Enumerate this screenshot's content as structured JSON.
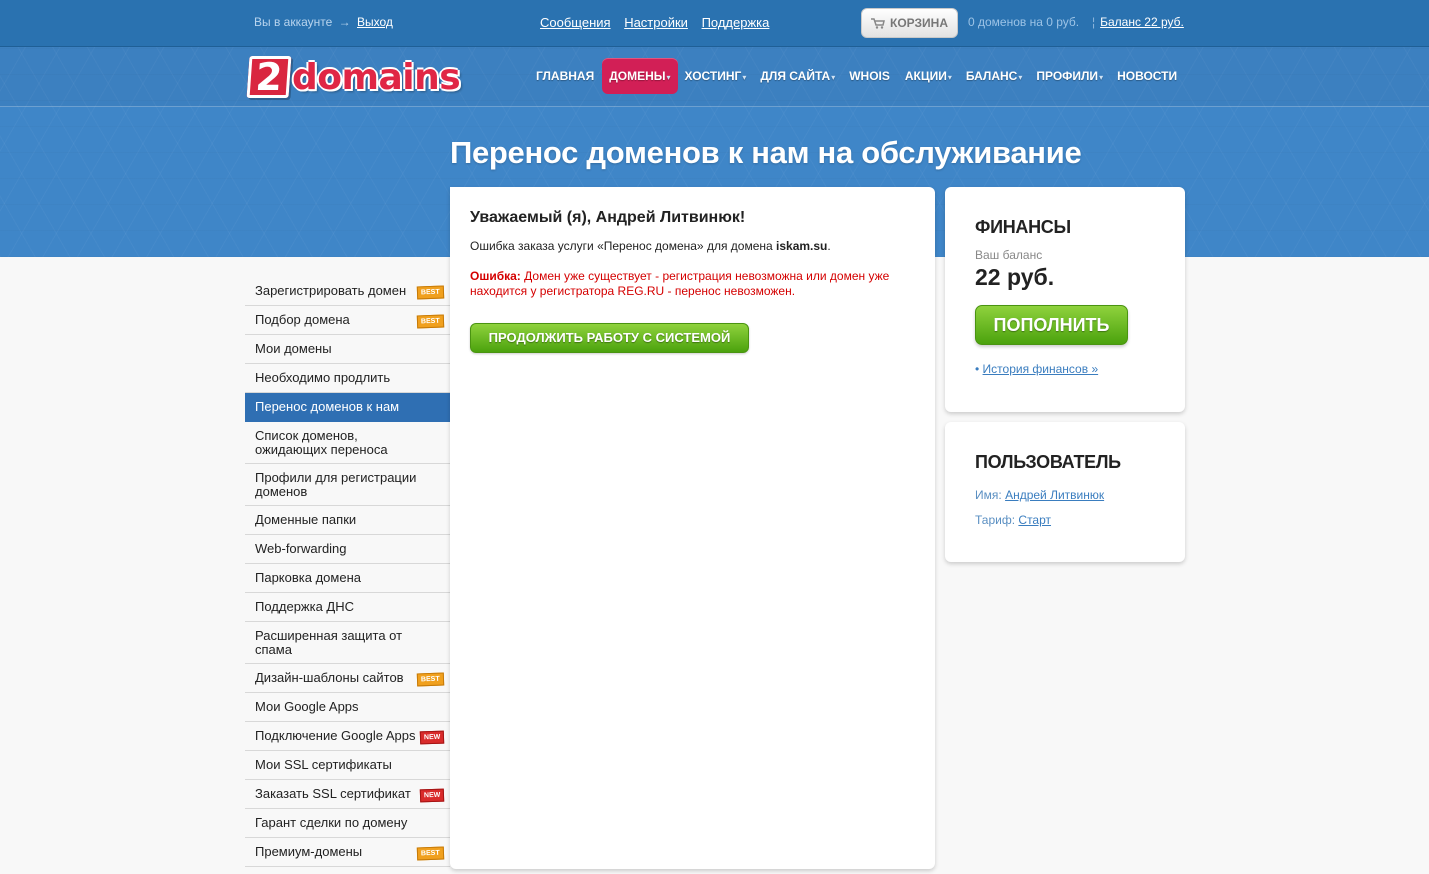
{
  "topbar": {
    "account_text": "Вы в аккаунте",
    "account_arrow": "→",
    "logout": "Выход",
    "links": [
      "Сообщения",
      "Настройки",
      "Поддержка"
    ],
    "cart_label": "КОРЗИНА",
    "cart_info": "0 доменов на 0 руб.",
    "balance_link": "Баланс 22 руб."
  },
  "logo": {
    "digit": "2",
    "word": "domains"
  },
  "nav": {
    "items": [
      {
        "label": "ГЛАВНАЯ",
        "caret": ""
      },
      {
        "label": "ДОМЕНЫ",
        "caret": "▾",
        "active": true
      },
      {
        "label": "ХОСТИНГ",
        "caret": "▾"
      },
      {
        "label": "ДЛЯ САЙТА",
        "caret": "▾"
      },
      {
        "label": "WHOIS",
        "caret": ""
      },
      {
        "label": "АКЦИИ",
        "caret": "▾"
      },
      {
        "label": "БАЛАНС",
        "caret": "▾"
      },
      {
        "label": "ПРОФИЛИ",
        "caret": "▾"
      },
      {
        "label": "НОВОСТИ",
        "caret": ""
      }
    ]
  },
  "page_title": "Перенос доменов к нам на обслуживание",
  "sidebar": {
    "items": [
      {
        "label": "Зарегистрировать домен",
        "badge": "BEST"
      },
      {
        "label": "Подбор домена",
        "badge": "BEST"
      },
      {
        "label": "Мои домены",
        "badge": ""
      },
      {
        "label": "Необходимо продлить",
        "badge": ""
      },
      {
        "label": "Перенос доменов к нам",
        "badge": "",
        "active": true
      },
      {
        "label": "Список доменов, ожидающих переноса",
        "badge": ""
      },
      {
        "label": "Профили для регистрации доменов",
        "badge": ""
      },
      {
        "label": "Доменные папки",
        "badge": ""
      },
      {
        "label": "Web-forwarding",
        "badge": ""
      },
      {
        "label": "Парковка домена",
        "badge": ""
      },
      {
        "label": "Поддержка ДНС",
        "badge": ""
      },
      {
        "label": "Расширенная защита от спама",
        "badge": ""
      },
      {
        "label": "Дизайн-шаблоны сайтов",
        "badge": "BEST"
      },
      {
        "label": "Мои Google Apps",
        "badge": ""
      },
      {
        "label": "Подключение Google Apps",
        "badge": "NEW"
      },
      {
        "label": "Мои SSL сертификаты",
        "badge": ""
      },
      {
        "label": "Заказать SSL сертификат",
        "badge": "NEW"
      },
      {
        "label": "Гарант сделки по домену",
        "badge": ""
      },
      {
        "label": "Премиум-домены",
        "badge": "BEST"
      }
    ]
  },
  "main": {
    "greeting": "Уважаемый (я), Андрей Литвинюк!",
    "message_prefix": "Ошибка заказа услуги «Перенос домена» для домена ",
    "message_domain": "iskam.su",
    "message_suffix": ".",
    "error_label": "Ошибка:",
    "error_text": " Домен уже существует - регистрация невозможна или домен уже находится у регистратора REG.RU - перенос невозможен.",
    "continue_button": "ПРОДОЛЖИТЬ РАБОТУ С СИСТЕМОЙ"
  },
  "finance": {
    "title": "ФИНАНСЫ",
    "balance_label": "Ваш баланс",
    "balance_value": "22 руб.",
    "topup_button": "ПОПОЛНИТЬ",
    "history_bullet": "•",
    "history_link": "История финансов »"
  },
  "user": {
    "title": "ПОЛЬЗОВАТЕЛЬ",
    "name_label": "Имя:",
    "name_value": "Андрей Литвинюк",
    "tariff_label": "Тариф:",
    "tariff_value": "Старт"
  },
  "colors": {
    "topbar": "#2a72b0",
    "header": "#3f86c8",
    "active_nav": "#d21f56",
    "active_sidebar": "#2f6fb3",
    "button_green": "#4ba20d",
    "error_red": "#d40000"
  }
}
